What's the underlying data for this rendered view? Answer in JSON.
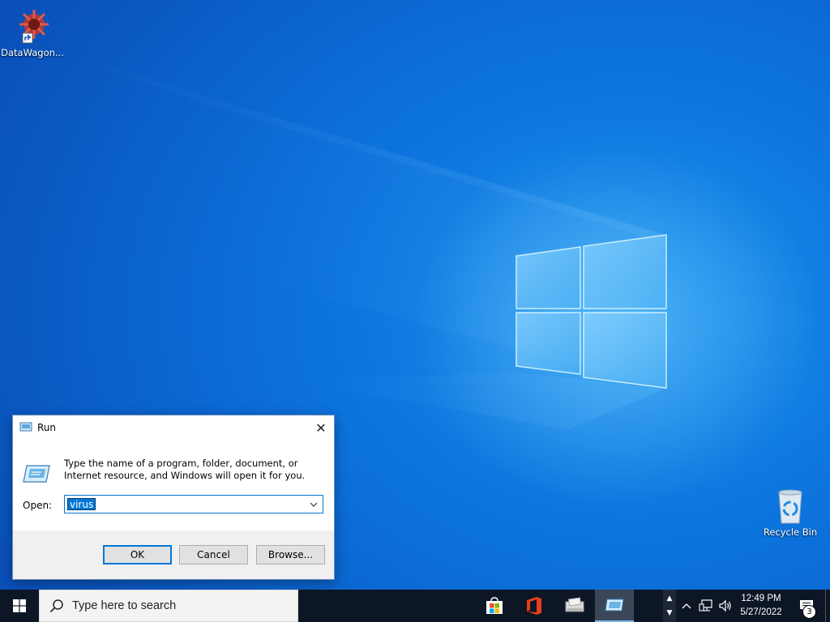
{
  "desktop": {
    "icons": [
      {
        "label": "DataWagon...",
        "icon": "datawagon-gear-shortcut-icon"
      },
      {
        "label": "Recycle Bin",
        "icon": "recycle-bin-icon"
      }
    ]
  },
  "run_dialog": {
    "title": "Run",
    "description": "Type the name of a program, folder, document, or Internet resource, and Windows will open it for you.",
    "open_label": "Open:",
    "open_value": "virus",
    "ok_label": "OK",
    "cancel_label": "Cancel",
    "browse_label": "Browse...",
    "icon": "run-icon"
  },
  "taskbar": {
    "search_placeholder": "Type here to search",
    "pinned_apps": [
      {
        "name": "microsoft-store",
        "icon": "store-icon"
      },
      {
        "name": "office",
        "icon": "office-icon"
      },
      {
        "name": "app-3",
        "icon": "mail-scanner-icon"
      },
      {
        "name": "run",
        "icon": "run-icon",
        "active": true
      }
    ],
    "clock": {
      "time": "12:49 PM",
      "date": "5/27/2022"
    },
    "notifications_count": "3"
  },
  "colors": {
    "accent": "#0078d7",
    "taskbar": "#0d1625",
    "desktop": "#0c72dc"
  }
}
